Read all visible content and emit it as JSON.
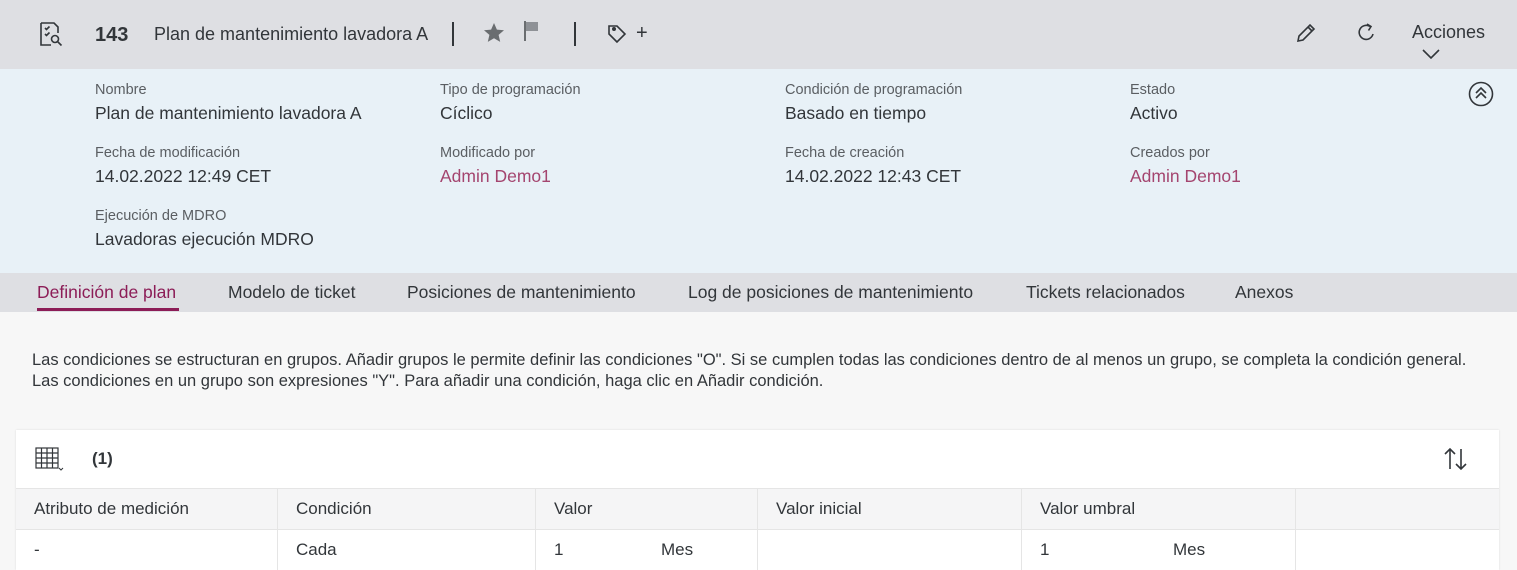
{
  "topbar": {
    "object_id": "143",
    "object_title": "Plan de mantenimiento lavadora A",
    "tag_add": "+",
    "actions_label": "Acciones"
  },
  "header": {
    "fields": [
      {
        "label": "Nombre",
        "value": "Plan de mantenimiento lavadora A"
      },
      {
        "label": "Tipo de programación",
        "value": "Cíclico"
      },
      {
        "label": "Condición de programación",
        "value": "Basado en tiempo"
      },
      {
        "label": "Estado",
        "value": "Activo"
      },
      {
        "label": "Fecha de modificación",
        "value": "14.02.2022 12:49 CET"
      },
      {
        "label": "Modificado por",
        "value": "Admin Demo1"
      },
      {
        "label": "Fecha de creación",
        "value": "14.02.2022 12:43 CET"
      },
      {
        "label": "Creados por",
        "value": "Admin Demo1"
      },
      {
        "label": "Ejecución de MDRO",
        "value": "Lavadoras ejecución MDRO"
      }
    ]
  },
  "tabs": [
    {
      "label": "Definición de plan"
    },
    {
      "label": "Modelo de ticket"
    },
    {
      "label": "Posiciones de mantenimiento"
    },
    {
      "label": "Log de posiciones de mantenimiento"
    },
    {
      "label": "Tickets relacionados"
    },
    {
      "label": "Anexos"
    }
  ],
  "content": {
    "description_line1": "Las condiciones se estructuran en grupos. Añadir grupos le permite definir las condiciones \"O\". Si se cumplen todas las condiciones dentro de al menos un grupo, se completa la condición general.",
    "description_line2": "Las condiciones en un grupo son expresiones \"Y\". Para añadir una condición, haga clic en Añadir condición."
  },
  "table": {
    "count": "(1)",
    "columns": [
      "Atributo de medición",
      "Condición",
      "Valor",
      "Valor inicial",
      "Valor umbral",
      ""
    ],
    "rows": [
      {
        "attribute": "-",
        "condition": "Cada",
        "value": "1",
        "value_unit": "Mes",
        "initial_value": "",
        "threshold_value": "1",
        "threshold_unit": "Mes"
      }
    ]
  },
  "colors": {
    "accent": "#8c1d57",
    "link": "#a4456f",
    "shell": "#dedfe3",
    "header_bg": "#e8f1f7"
  }
}
